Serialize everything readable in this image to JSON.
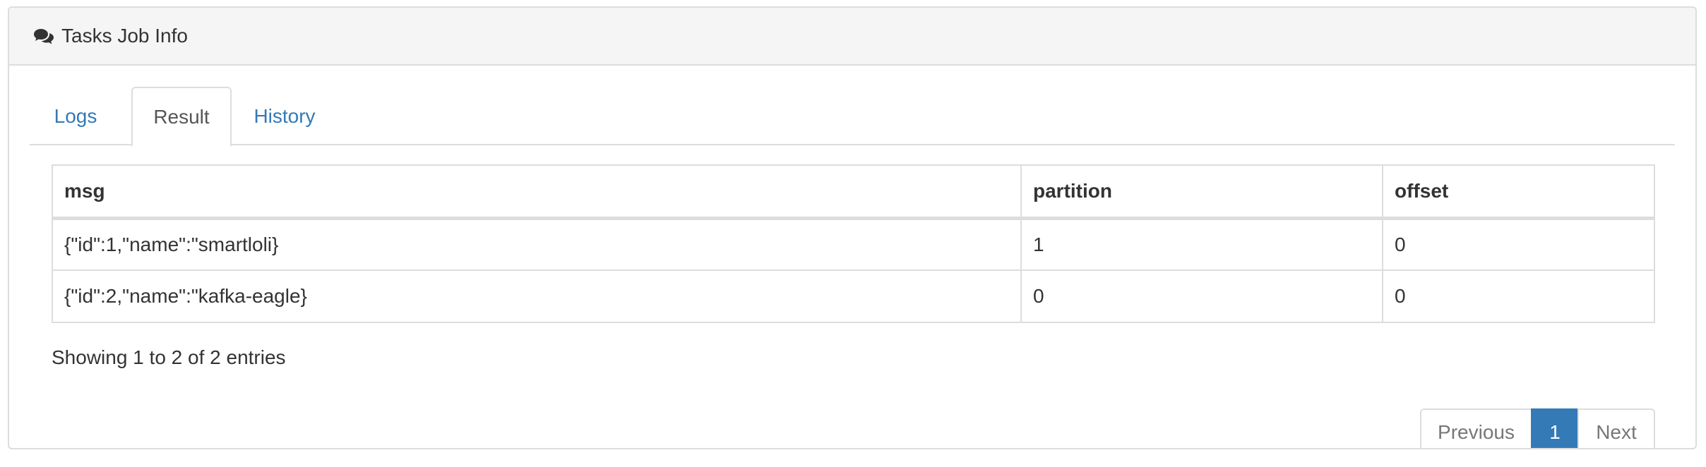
{
  "panel": {
    "title": "Tasks Job Info",
    "icon": "comments-icon"
  },
  "tabs": [
    {
      "label": "Logs",
      "active": false
    },
    {
      "label": "Result",
      "active": true
    },
    {
      "label": "History",
      "active": false
    }
  ],
  "table": {
    "headers": [
      "msg",
      "partition",
      "offset"
    ],
    "rows": [
      [
        "{\"id\":1,\"name\":\"smartloli}",
        "1",
        "0"
      ],
      [
        "{\"id\":2,\"name\":\"kafka-eagle}",
        "0",
        "0"
      ]
    ]
  },
  "info": "Showing 1 to 2 of 2 entries",
  "pagination": {
    "previous": "Previous",
    "current": "1",
    "next": "Next"
  },
  "colors": {
    "link": "#337ab7",
    "active_page": "#337ab7",
    "border": "#dddddd",
    "heading_bg": "#f5f5f5"
  }
}
